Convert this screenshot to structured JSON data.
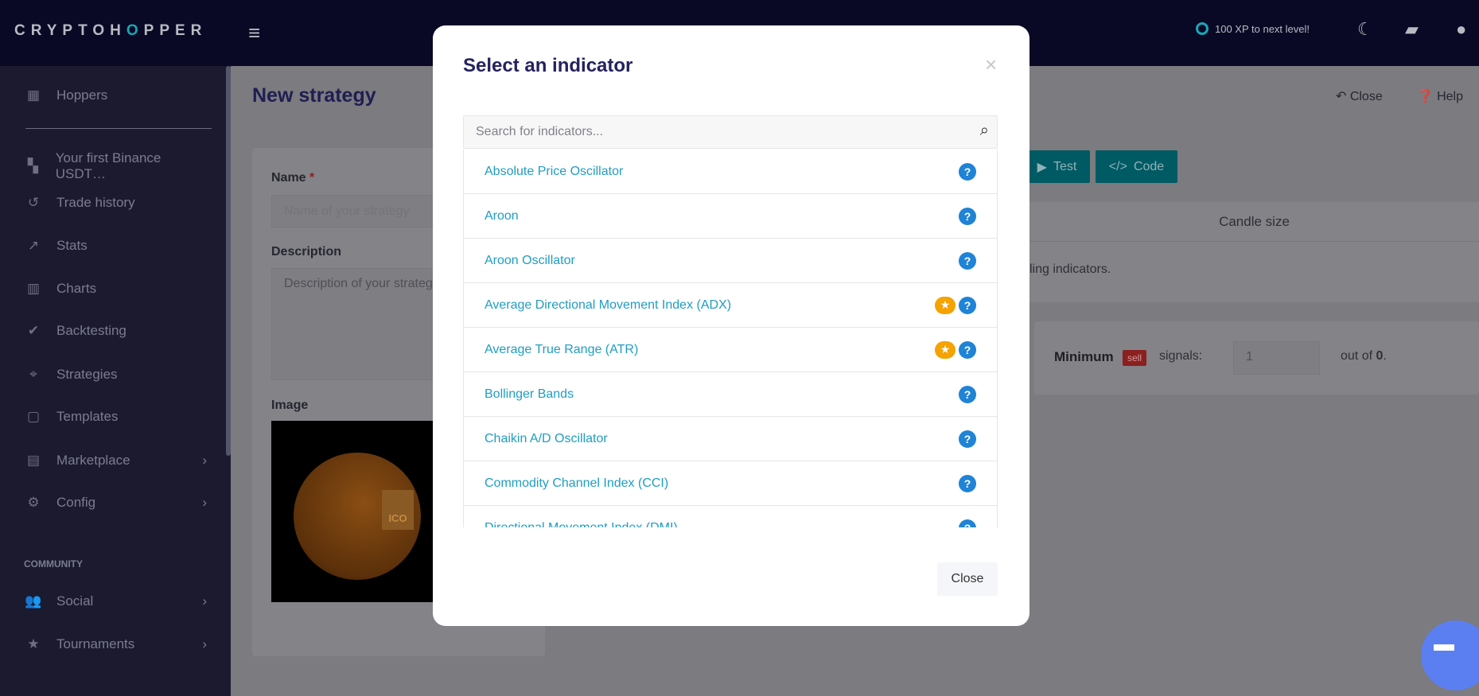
{
  "topbar": {
    "logo": "CRYPTOHOPPER",
    "xp_text": "100 XP to next level!"
  },
  "sidebar": {
    "items": [
      {
        "label": "Hoppers",
        "icon": "grid-icon",
        "ic": "▦"
      },
      {
        "label": "Your first Binance USDT…",
        "icon": "dashboard-icon",
        "ic": "▚"
      },
      {
        "label": "Trade history",
        "icon": "history-icon",
        "ic": "↺"
      },
      {
        "label": "Stats",
        "icon": "trend-icon",
        "ic": "↗"
      },
      {
        "label": "Charts",
        "icon": "bar-chart-icon",
        "ic": "▥"
      },
      {
        "label": "Backtesting",
        "icon": "double-check-icon",
        "ic": "✔"
      },
      {
        "label": "Strategies",
        "icon": "crosshair-icon",
        "ic": "⌖"
      },
      {
        "label": "Templates",
        "icon": "clipboard-icon",
        "ic": "▢"
      },
      {
        "label": "Marketplace",
        "icon": "store-icon",
        "ic": "▤",
        "chevron": true
      },
      {
        "label": "Config",
        "icon": "gear-icon",
        "ic": "⚙",
        "chevron": true
      }
    ],
    "community_heading": "COMMUNITY",
    "community_items": [
      {
        "label": "Social",
        "icon": "users-icon",
        "ic": "👥",
        "chevron": true
      },
      {
        "label": "Tournaments",
        "icon": "ticket-icon",
        "ic": "★",
        "chevron": true
      }
    ]
  },
  "page": {
    "title": "New strategy",
    "close_label": "Close",
    "help_label": "Help",
    "name_label": "Name",
    "required_mark": "*",
    "name_placeholder": "Name of your strategy",
    "description_label": "Description",
    "description_placeholder": "Description of your strategy",
    "image_label": "Image",
    "image_badge": "ICO",
    "test_label": "Test",
    "code_label": "Code",
    "candle_size_header": "Candle size",
    "table_text": "ling indicators.",
    "minimum_label": "Minimum",
    "sell_badge": "sell",
    "signals_label": "signals:",
    "min_value": "1",
    "out_of_prefix": "out of ",
    "out_of_value": "0",
    "out_of_suffix": "."
  },
  "modal": {
    "title": "Select an indicator",
    "search_placeholder": "Search for indicators...",
    "close_button": "Close",
    "indicators": [
      {
        "name": "Absolute Price Oscillator",
        "premium": false
      },
      {
        "name": "Aroon",
        "premium": false
      },
      {
        "name": "Aroon Oscillator",
        "premium": false
      },
      {
        "name": "Average Directional Movement Index (ADX)",
        "premium": true
      },
      {
        "name": "Average True Range (ATR)",
        "premium": true
      },
      {
        "name": "Bollinger Bands",
        "premium": false
      },
      {
        "name": "Chaikin A/D Oscillator",
        "premium": false
      },
      {
        "name": "Commodity Channel Index (CCI)",
        "premium": false
      },
      {
        "name": "Directional Movement Index (DMI)",
        "premium": false
      }
    ]
  },
  "colors": {
    "accent": "#1f9dc2",
    "help": "#1f83d6",
    "premium": "#f4a300",
    "topbar": "#090925"
  }
}
